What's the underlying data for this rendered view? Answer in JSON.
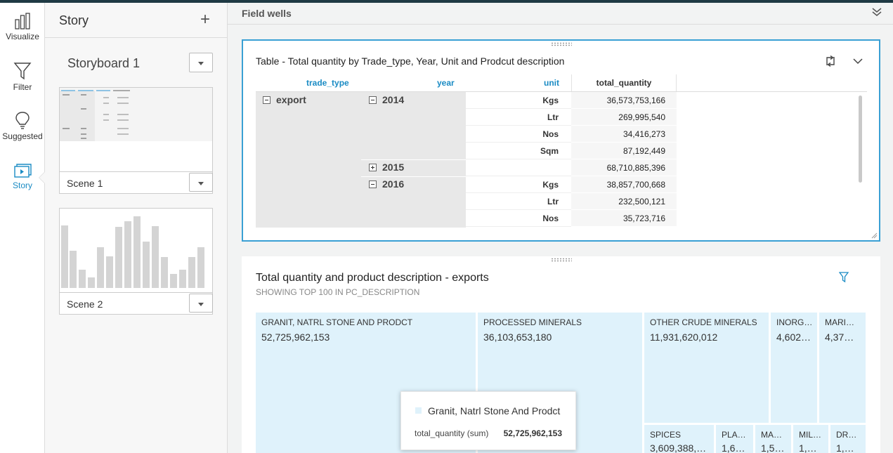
{
  "rail": {
    "items": [
      {
        "label": "Visualize"
      },
      {
        "label": "Filter"
      },
      {
        "label": "Suggested"
      },
      {
        "label": "Story"
      }
    ]
  },
  "story_panel": {
    "title": "Story",
    "add_icon": "+",
    "storyboard_name": "Storyboard 1",
    "scenes": [
      {
        "label": "Scene 1"
      },
      {
        "label": "Scene 2"
      }
    ]
  },
  "field_wells": {
    "label": "Field wells"
  },
  "table_visual": {
    "title": "Table - Total quantity by Trade_type, Year, Unit and Prodcut description",
    "headers": {
      "trade_type": "trade_type",
      "year": "year",
      "unit": "unit",
      "measure": "total_quantity"
    },
    "trade_type": "export",
    "years": [
      {
        "year": "2014",
        "expanded": true,
        "rows": [
          {
            "unit": "Kgs",
            "value": "36,573,753,166"
          },
          {
            "unit": "Ltr",
            "value": "269,995,540"
          },
          {
            "unit": "Nos",
            "value": "34,416,273"
          },
          {
            "unit": "Sqm",
            "value": "87,192,449"
          }
        ]
      },
      {
        "year": "2015",
        "expanded": false,
        "rows": [
          {
            "unit": "",
            "value": "68,710,885,396"
          }
        ]
      },
      {
        "year": "2016",
        "expanded": true,
        "rows": [
          {
            "unit": "Kgs",
            "value": "38,857,700,668"
          },
          {
            "unit": "Ltr",
            "value": "232,500,121"
          },
          {
            "unit": "Nos",
            "value": "35,723,716"
          }
        ]
      }
    ]
  },
  "treemap_visual": {
    "title": "Total quantity and product description - exports",
    "subtitle": "SHOWING TOP 100 IN PC_DESCRIPTION",
    "tiles": [
      {
        "name": "GRANIT, NATRL STONE AND PRODCT",
        "value": "52,725,962,153"
      },
      {
        "name": "PROCESSED MINERALS",
        "value": "36,103,653,180"
      },
      {
        "name": "OTHER CRUDE MINERALS",
        "value": "11,931,620,012"
      },
      {
        "name": "INORG…",
        "value": "4,602…"
      },
      {
        "name": "MARI…",
        "value": "4,37…"
      },
      {
        "name": "SPICES",
        "value": "3,609,388,…"
      },
      {
        "name": "PLA…",
        "value": "1,6…"
      },
      {
        "name": "MA…",
        "value": "1,5…"
      },
      {
        "name": "MIL…",
        "value": "1,…"
      },
      {
        "name": "DR…",
        "value": "1,…"
      }
    ],
    "tooltip": {
      "title": "Granit, Natrl Stone And Prodct",
      "key": "total_quantity (sum)",
      "value": "52,725,962,153"
    },
    "tile_color": "#dff2fb"
  },
  "colors": {
    "accent": "#1a8bc4",
    "selected_border": "#3aa0d4",
    "top_bar": "#1f3a44"
  }
}
